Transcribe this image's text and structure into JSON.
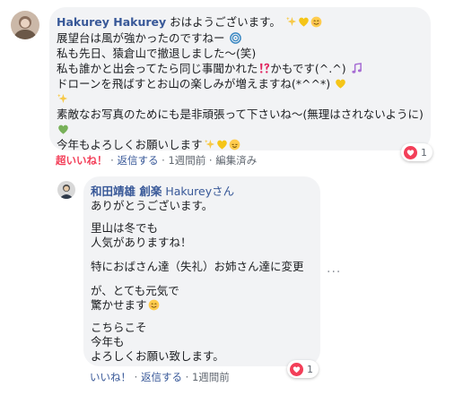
{
  "comment1": {
    "author": "Hakurey Hakurey",
    "lines": [
      "おはようございます。",
      "展望台は風が強かったのですねー",
      "私も先日、猿倉山で撤退しました～(笑)",
      "私も誰かと出会ってたら同じ事聞かれた",
      "かもです(^.^)",
      "ドローンを飛ばすとお山の楽しみが増えますね(*^^*)",
      "素敵なお写真のためにも是非頑張って下さいね～(無理はされないように)",
      "今年もよろしくお願いします"
    ],
    "actions": {
      "reaction": "超いいね！",
      "reply": "返信する",
      "time": "1週間前",
      "edited": "編集済み"
    },
    "reaction_count": "1"
  },
  "reply1": {
    "author": "和田靖雄 創楽",
    "mention": "Hakureyさん",
    "lines": [
      "ありがとうございます。",
      "里山は冬でも",
      "人気がありますね！",
      "特におばさん達（失礼）お姉さん達に変更",
      "が、とても元気で",
      "驚かせます",
      "こちらこそ",
      "今年も",
      "よろしくお願い致します。"
    ],
    "actions": {
      "like": "いいね！",
      "reply": "返信する",
      "time": "1週間前"
    },
    "reaction_count": "1"
  },
  "icons": {
    "sparkle": "sparkles-icon",
    "heart": "yellow-heart-icon",
    "smile": "smiling-face-icon",
    "cyclone": "cyclone-icon",
    "interrobang": "exclamation-question-icon",
    "note": "musical-note-icon",
    "green_heart": "green-heart-icon",
    "relieved": "relieved-face-icon",
    "love": "love-reaction-icon",
    "more": "more-options-icon"
  },
  "colors": {
    "link": "#385898",
    "reaction_red": "#f33e58",
    "bubble": "#f2f3f5",
    "meta": "#606770"
  }
}
